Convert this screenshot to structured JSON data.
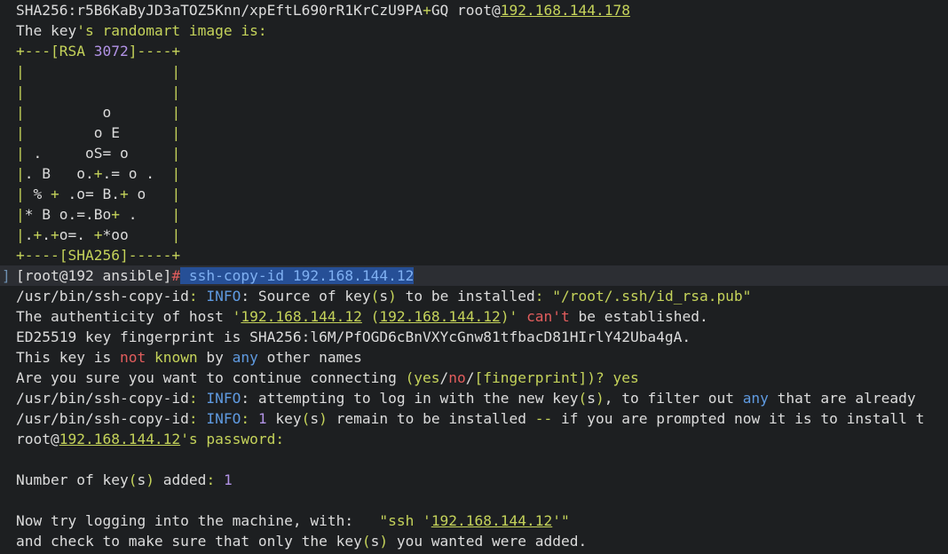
{
  "terminal": {
    "lines": [
      [
        {
          "t": "SHA256:r5B6KaByJD3aTOZ5Knn/xpEftL690rR1KrCzU9PA",
          "c": "w"
        },
        {
          "t": "+",
          "c": "g"
        },
        {
          "t": "GQ root@",
          "c": "w"
        },
        {
          "t": "192.168.144.178",
          "c": "u"
        }
      ],
      [
        {
          "t": "The key",
          "c": "w"
        },
        {
          "t": "'s randomart",
          "c": "g"
        },
        {
          "t": " image is:",
          "c": "g"
        }
      ],
      [
        {
          "t": "+---[RSA ",
          "c": "g"
        },
        {
          "t": "3072",
          "c": "p"
        },
        {
          "t": "]----+",
          "c": "g"
        }
      ],
      [
        {
          "t": "|                 |",
          "c": "g"
        }
      ],
      [
        {
          "t": "|                 |",
          "c": "g"
        }
      ],
      [
        {
          "t": "|",
          "c": "g"
        },
        {
          "t": "         o       ",
          "c": "w"
        },
        {
          "t": "|",
          "c": "g"
        }
      ],
      [
        {
          "t": "|",
          "c": "g"
        },
        {
          "t": "        o E      ",
          "c": "w"
        },
        {
          "t": "|",
          "c": "g"
        }
      ],
      [
        {
          "t": "|",
          "c": "g"
        },
        {
          "t": " .     oS= o     ",
          "c": "w"
        },
        {
          "t": "|",
          "c": "g"
        }
      ],
      [
        {
          "t": "|",
          "c": "g"
        },
        {
          "t": ". B   o.",
          "c": "w"
        },
        {
          "t": "+",
          "c": "g"
        },
        {
          "t": ".= o .  ",
          "c": "w"
        },
        {
          "t": "|",
          "c": "g"
        }
      ],
      [
        {
          "t": "|",
          "c": "g"
        },
        {
          "t": " % ",
          "c": "w"
        },
        {
          "t": "+",
          "c": "g"
        },
        {
          "t": " .o= B.",
          "c": "w"
        },
        {
          "t": "+",
          "c": "g"
        },
        {
          "t": " o   ",
          "c": "w"
        },
        {
          "t": "|",
          "c": "g"
        }
      ],
      [
        {
          "t": "|",
          "c": "g"
        },
        {
          "t": "* B o.=.Bo",
          "c": "w"
        },
        {
          "t": "+",
          "c": "g"
        },
        {
          "t": " .    ",
          "c": "w"
        },
        {
          "t": "|",
          "c": "g"
        }
      ],
      [
        {
          "t": "|",
          "c": "g"
        },
        {
          "t": ".",
          "c": "w"
        },
        {
          "t": "+",
          "c": "g"
        },
        {
          "t": ".",
          "c": "w"
        },
        {
          "t": "+",
          "c": "g"
        },
        {
          "t": "o=. ",
          "c": "w"
        },
        {
          "t": "+",
          "c": "g"
        },
        {
          "t": "*oo     ",
          "c": "w"
        },
        {
          "t": "|",
          "c": "g"
        }
      ],
      [
        {
          "t": "+----[SHA256]-----+",
          "c": "g"
        }
      ],
      [
        {
          "t": "[root@192 ansible]",
          "c": "w"
        },
        {
          "t": "#",
          "c": "r"
        },
        {
          "t": " ssh-copy-id 192.168.144.12",
          "c": "sel"
        }
      ],
      [
        {
          "t": "/usr/bin/ssh-copy-id",
          "c": "w"
        },
        {
          "t": ": ",
          "c": "g"
        },
        {
          "t": "INFO",
          "c": "b"
        },
        {
          "t": ": Source of key",
          "c": "w"
        },
        {
          "t": "(",
          "c": "g"
        },
        {
          "t": "s",
          "c": "w"
        },
        {
          "t": ")",
          "c": "g"
        },
        {
          "t": " to be installed",
          "c": "w"
        },
        {
          "t": ": \"/root/.ssh/id_rsa.pub\"",
          "c": "g"
        }
      ],
      [
        {
          "t": "The authenticity of host ",
          "c": "w"
        },
        {
          "t": "'",
          "c": "g"
        },
        {
          "t": "192.168.144.12",
          "c": "u"
        },
        {
          "t": " (",
          "c": "g"
        },
        {
          "t": "192.168.144.12",
          "c": "u"
        },
        {
          "t": ")' ",
          "c": "g"
        },
        {
          "t": "can't",
          "c": "r"
        },
        {
          "t": " be established.",
          "c": "w"
        }
      ],
      [
        {
          "t": "ED25519 key fingerprint is SHA256:l6M/PfOGD6cBnVXYcGnw81tfbacD81HIrlY42Uba4gA.",
          "c": "w"
        }
      ],
      [
        {
          "t": "This key is ",
          "c": "w"
        },
        {
          "t": "not",
          "c": "r"
        },
        {
          "t": " ",
          "c": "w"
        },
        {
          "t": "known",
          "c": "g"
        },
        {
          "t": " by ",
          "c": "w"
        },
        {
          "t": "any",
          "c": "b"
        },
        {
          "t": " other names",
          "c": "w"
        }
      ],
      [
        {
          "t": "Are you sure you want to continue connecting ",
          "c": "w"
        },
        {
          "t": "(yes",
          "c": "g"
        },
        {
          "t": "/",
          "c": "w"
        },
        {
          "t": "no",
          "c": "r"
        },
        {
          "t": "/",
          "c": "w"
        },
        {
          "t": "[fingerprint])? yes",
          "c": "g"
        }
      ],
      [
        {
          "t": "/usr/bin/ssh-copy-id",
          "c": "w"
        },
        {
          "t": ": ",
          "c": "g"
        },
        {
          "t": "INFO",
          "c": "b"
        },
        {
          "t": ": attempting to log in with the new key",
          "c": "w"
        },
        {
          "t": "(",
          "c": "g"
        },
        {
          "t": "s",
          "c": "w"
        },
        {
          "t": ")",
          "c": "g"
        },
        {
          "t": ", to filter out ",
          "c": "w"
        },
        {
          "t": "any",
          "c": "b"
        },
        {
          "t": " that are already",
          "c": "w"
        }
      ],
      [
        {
          "t": "/usr/bin/ssh-copy-id",
          "c": "w"
        },
        {
          "t": ": ",
          "c": "g"
        },
        {
          "t": "INFO",
          "c": "b"
        },
        {
          "t": ": ",
          "c": "g"
        },
        {
          "t": "1",
          "c": "p"
        },
        {
          "t": " key",
          "c": "w"
        },
        {
          "t": "(",
          "c": "g"
        },
        {
          "t": "s",
          "c": "w"
        },
        {
          "t": ")",
          "c": "g"
        },
        {
          "t": " remain to be installed ",
          "c": "w"
        },
        {
          "t": "--",
          "c": "g"
        },
        {
          "t": " if you are prompted now it is to install t",
          "c": "w"
        }
      ],
      [
        {
          "t": "root@",
          "c": "w"
        },
        {
          "t": "192.168.144.12",
          "c": "u"
        },
        {
          "t": "'s password:",
          "c": "g"
        }
      ],
      [],
      [
        {
          "t": "Number of key",
          "c": "w"
        },
        {
          "t": "(",
          "c": "g"
        },
        {
          "t": "s",
          "c": "w"
        },
        {
          "t": ")",
          "c": "g"
        },
        {
          "t": " added",
          "c": "w"
        },
        {
          "t": ": ",
          "c": "g"
        },
        {
          "t": "1",
          "c": "p"
        }
      ],
      [],
      [
        {
          "t": "Now try logging into the machine, with:   ",
          "c": "w"
        },
        {
          "t": "\"ssh '",
          "c": "g"
        },
        {
          "t": "192.168.144.12",
          "c": "u"
        },
        {
          "t": "'\"",
          "c": "g"
        }
      ],
      [
        {
          "t": "and check to make sure that only the key",
          "c": "w"
        },
        {
          "t": "(",
          "c": "g"
        },
        {
          "t": "s",
          "c": "w"
        },
        {
          "t": ")",
          "c": "g"
        },
        {
          "t": " you wanted were added.",
          "c": "w"
        }
      ]
    ],
    "current_line": 13,
    "gutter_mark": "]"
  }
}
